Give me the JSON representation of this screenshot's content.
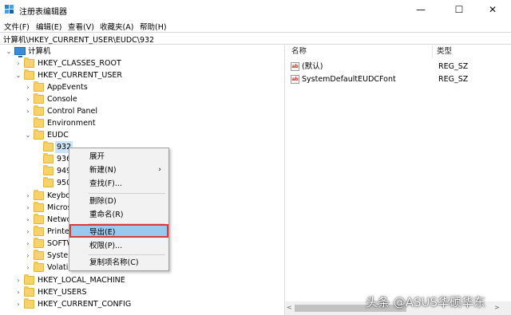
{
  "window": {
    "title": "注册表编辑器",
    "minimize_glyph": "—",
    "maximize_glyph": "☐",
    "close_glyph": "✕"
  },
  "menubar": {
    "items": [
      "文件(F)",
      "编辑(E)",
      "查看(V)",
      "收藏夹(A)",
      "帮助(H)"
    ]
  },
  "address": {
    "path": "计算机\\HKEY_CURRENT_USER\\EUDC\\932"
  },
  "tree": {
    "root": "计算机",
    "hkcr": "HKEY_CLASSES_ROOT",
    "hkcu": "HKEY_CURRENT_USER",
    "appevents": "AppEvents",
    "console": "Console",
    "control_panel": "Control Panel",
    "environment": "Environment",
    "eudc": "EUDC",
    "k932": "932",
    "k936": "936",
    "k949": "949",
    "k950": "950",
    "keyboard": "Keybo",
    "microsoft": "Micros",
    "network": "Netwo",
    "printers": "Printer",
    "software": "SOFTW",
    "system": "System",
    "volatile": "Volatile Environment",
    "hklm": "HKEY_LOCAL_MACHINE",
    "hku": "HKEY_USERS",
    "hkcc": "HKEY_CURRENT_CONFIG",
    "expanded_glyph": "⌄",
    "collapsed_glyph": "›"
  },
  "list": {
    "columns": {
      "name": "名称",
      "type": "类型"
    },
    "rows": [
      {
        "name": "(默认)",
        "type": "REG_SZ"
      },
      {
        "name": "SystemDefaultEUDCFont",
        "type": "REG_SZ"
      }
    ],
    "value_icon": "ab"
  },
  "context_menu": {
    "expand": "展开",
    "new": "新建(N)",
    "find": "查找(F)...",
    "delete": "删除(D)",
    "rename": "重命名(R)",
    "export": "导出(E)",
    "permissions": "权限(P)...",
    "copy_key_name": "复制项名称(C)",
    "submenu_arrow": "›"
  },
  "watermark": {
    "text": "头条 @ASUS华硕华东"
  },
  "scrollbar": {
    "left_arrow": "<",
    "right_arrow": ">"
  }
}
